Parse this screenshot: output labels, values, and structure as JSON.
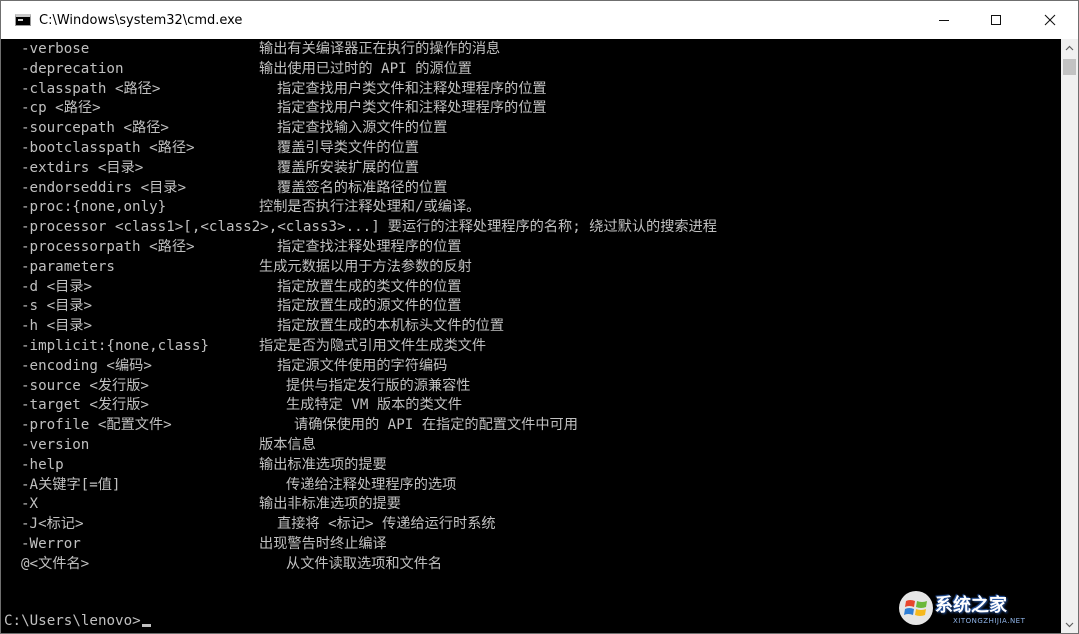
{
  "window": {
    "title": "C:\\Windows\\system32\\cmd.exe",
    "minimize_icon": "minimize-icon",
    "maximize_icon": "maximize-icon",
    "close_icon": "close-icon"
  },
  "console": {
    "lines": [
      {
        "option": "-verbose",
        "description": "输出有关编译器正在执行的操作的消息"
      },
      {
        "option": "-deprecation",
        "description": "输出使用已过时的 API 的源位置"
      },
      {
        "option": "-classpath <路径>",
        "description": "指定查找用户类文件和注释处理程序的位置"
      },
      {
        "option": "-cp <路径>",
        "description": "指定查找用户类文件和注释处理程序的位置"
      },
      {
        "option": "-sourcepath <路径>",
        "description": "指定查找输入源文件的位置"
      },
      {
        "option": "-bootclasspath <路径>",
        "description": "覆盖引导类文件的位置"
      },
      {
        "option": "-extdirs <目录>",
        "description": "覆盖所安装扩展的位置"
      },
      {
        "option": "-endorseddirs <目录>",
        "description": "覆盖签名的标准路径的位置"
      },
      {
        "option": "-proc:{none,only}",
        "description": "控制是否执行注释处理和/或编译。"
      },
      {
        "option": "-processor <class1>[,<class2>,<class3>...]",
        "description": "要运行的注释处理程序的名称; 绕过默认的搜索进程"
      },
      {
        "option": "-processorpath <路径>",
        "description": "指定查找注释处理程序的位置"
      },
      {
        "option": "-parameters",
        "description": "生成元数据以用于方法参数的反射"
      },
      {
        "option": "-d <目录>",
        "description": "指定放置生成的类文件的位置"
      },
      {
        "option": "-s <目录>",
        "description": "指定放置生成的源文件的位置"
      },
      {
        "option": "-h <目录>",
        "description": "指定放置生成的本机标头文件的位置"
      },
      {
        "option": "-implicit:{none,class}",
        "description": "指定是否为隐式引用文件生成类文件"
      },
      {
        "option": "-encoding <编码>",
        "description": "指定源文件使用的字符编码"
      },
      {
        "option": "-source <发行版>",
        "description": "提供与指定发行版的源兼容性"
      },
      {
        "option": "-target <发行版>",
        "description": "生成特定 VM 版本的类文件"
      },
      {
        "option": "-profile <配置文件>",
        "description": "请确保使用的 API 在指定的配置文件中可用"
      },
      {
        "option": "-version",
        "description": "版本信息"
      },
      {
        "option": "-help",
        "description": "输出标准选项的提要"
      },
      {
        "option": "-A关键字[=值]",
        "description": "传递给注释处理程序的选项"
      },
      {
        "option": "-X",
        "description": "输出非标准选项的提要"
      },
      {
        "option": "-J<标记>",
        "description": "直接将 <标记> 传递给运行时系统"
      },
      {
        "option": "-Werror",
        "description": "出现警告时终止编译"
      },
      {
        "option": "@<文件名>",
        "description": "从文件读取选项和文件名"
      }
    ],
    "prompt": "C:\\Users\\lenovo>"
  },
  "watermark": {
    "text": "系统之家",
    "subtext": "XITONGZHIJIA.NET"
  },
  "colors": {
    "console_bg": "#000000",
    "console_fg": "#c0c0c0",
    "titlebar_bg": "#ffffff"
  }
}
